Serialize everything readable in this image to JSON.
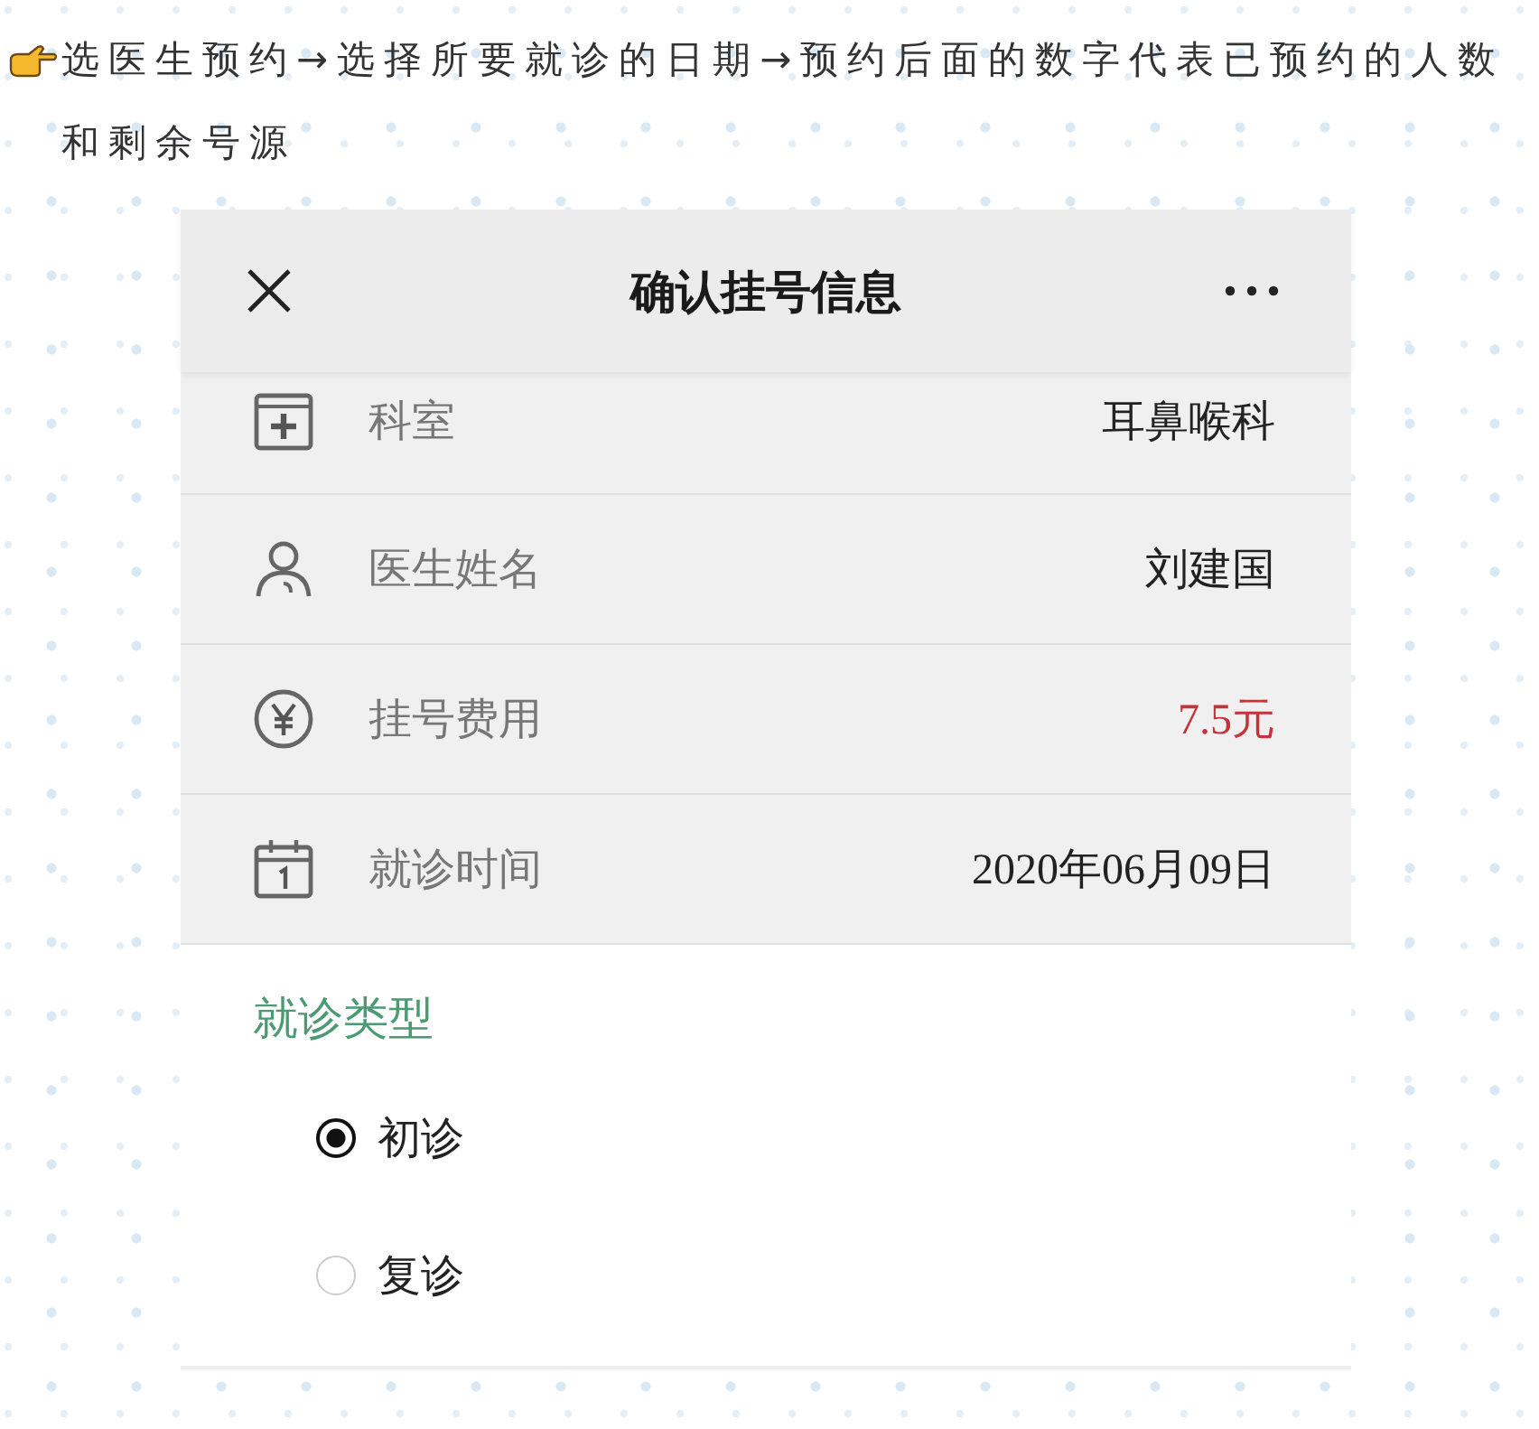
{
  "intro": {
    "text": "选医生预约→选择所要就诊的日期→预约后面的数字代表已预约的人数和剩余号源"
  },
  "app": {
    "title": "确认挂号信息",
    "rows": [
      {
        "kind": "department",
        "label": "科室",
        "value": "耳鼻喉科",
        "highlight": false
      },
      {
        "kind": "doctor",
        "label": "医生姓名",
        "value": "刘建国",
        "highlight": false
      },
      {
        "kind": "fee",
        "label": "挂号费用",
        "value": "7.5元",
        "highlight": true
      },
      {
        "kind": "date",
        "label": "就诊时间",
        "value": "2020年06月09日",
        "highlight": false
      }
    ],
    "visit_type": {
      "heading": "就诊类型",
      "options": [
        {
          "label": "初诊",
          "selected": true
        },
        {
          "label": "复诊",
          "selected": false
        }
      ]
    }
  }
}
